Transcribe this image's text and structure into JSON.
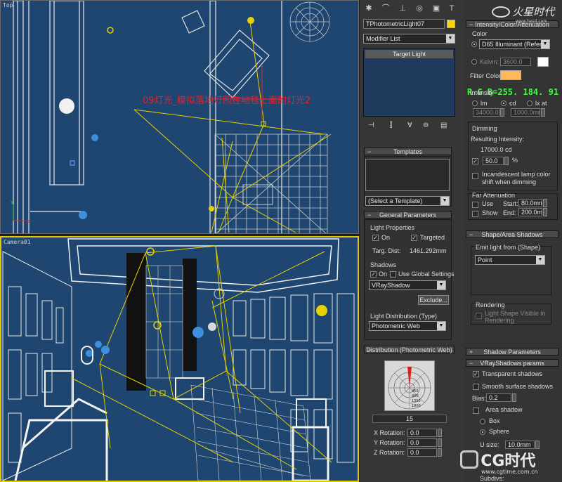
{
  "viewports": {
    "top": {
      "label": "Top"
    },
    "camera": {
      "label": "Camera01"
    }
  },
  "annotation": "09灯光_模拟落地灯照在地毯上面的灯光2",
  "rgb_readout": "R G B=255. 184. 91",
  "command_panel": {
    "object_name": "TPhotometricLight07",
    "modifier_list": "Modifier List",
    "stack_item": "Target Light"
  },
  "templates": {
    "title": "Templates",
    "select": "(Select a Template)"
  },
  "general": {
    "title": "General Parameters",
    "light_props": "Light Properties",
    "on": "On",
    "targeted": "Targeted",
    "targ_dist_label": "Targ. Dist:",
    "targ_dist": "1461.292mm",
    "shadows": "Shadows",
    "shadows_on": "On",
    "global": "Use Global Settings",
    "shadow_type": "VRayShadow",
    "exclude": "Exclude...",
    "dist_label": "Light Distribution (Type)",
    "dist_type": "Photometric Web"
  },
  "distribution": {
    "title": "Distribution (Photometric Web)",
    "web_value": "15",
    "web_rings": [
      "450",
      "900",
      "1350",
      "1800"
    ],
    "x_rot_label": "X Rotation:",
    "x_rot": "0.0",
    "y_rot_label": "Y Rotation:",
    "y_rot": "0.0",
    "z_rot_label": "Z Rotation:",
    "z_rot": "0.0"
  },
  "intensity": {
    "title": "Intensity/Color/Attenuation",
    "color_label": "Color",
    "illuminant": "D65 Illuminant (Reference",
    "kelvin_label": "Kelvin:",
    "kelvin": "3600.0",
    "filter_label": "Filter Color:",
    "filter_color": "#ffb85b",
    "intensity_label": "Intensity",
    "lm": "lm",
    "cd": "cd",
    "lx": "lx at",
    "int_value": "34000.0",
    "int_dist": "1000.0mm",
    "dimming_label": "Dimming",
    "resulting_label": "Resulting Intensity:",
    "resulting": "17000.0 cd",
    "dim_pct": "50.0",
    "pct": "%",
    "incandescent": "Incandescent lamp color",
    "incandescent2": "shift when dimming",
    "far_label": "Far Attenuation",
    "use": "Use",
    "start_label": "Start:",
    "start": "80.0mm",
    "show": "Show",
    "end_label": "End:",
    "end": "200.0mm"
  },
  "shape": {
    "title": "Shape/Area Shadows",
    "emit_label": "Emit light from (Shape)",
    "emit_shape": "Point",
    "rendering": "Rendering",
    "visible1": "Light Shape Visible in",
    "visible2": "Rendering"
  },
  "shadow_params": {
    "title": "Shadow Parameters"
  },
  "vray": {
    "title": "VRayShadows params",
    "transparent": "Transparent shadows",
    "smooth": "Smooth surface shadows",
    "bias_label": "Bias:",
    "bias": "0.2",
    "area": "Area shadow",
    "box": "Box",
    "sphere": "Sphere",
    "usize_label": "U size:",
    "usize": "10.0mm",
    "subdivs_label": "Subdivs:"
  },
  "logo": {
    "top_text": "火星时代",
    "top_url": "www.hxsd.com",
    "bottom_text": "CG时代",
    "bottom_url": "www.cgtime.com.cn"
  },
  "colors": {
    "viewport_bg": "#1e4670",
    "active_border": "#e6c800",
    "annotation": "#e8202a",
    "readout": "#3aff3a"
  }
}
